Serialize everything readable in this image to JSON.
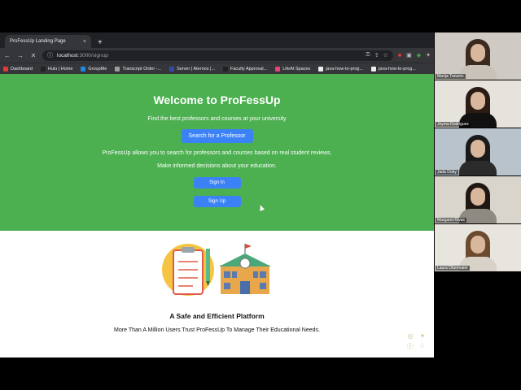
{
  "browser": {
    "tab": {
      "title": "ProFessUp Landing Page",
      "close": "×"
    },
    "new_tab": "+",
    "nav": {
      "back": "←",
      "forward": "→",
      "reload": "✕"
    },
    "address": {
      "host": "localhost",
      "path": ":3000/signup"
    },
    "bookmarks": [
      {
        "label": "Dashboard",
        "color": "#e53935"
      },
      {
        "label": "Hulu | Home",
        "color": "#222222"
      },
      {
        "label": "GroupMe",
        "color": "#1e88e5"
      },
      {
        "label": "Transcript Order -...",
        "color": "#9e9e9e"
      },
      {
        "label": "Server | Aternos |...",
        "color": "#3949ab"
      },
      {
        "label": "Faculty Approval...",
        "color": "#212121"
      },
      {
        "label": "LifeAt Spaces",
        "color": "#ec407a"
      },
      {
        "label": "java-how-to-prog...",
        "color": "#eeeeee"
      },
      {
        "label": "java-how-to-prog...",
        "color": "#eeeeee"
      }
    ]
  },
  "hero": {
    "title": "Welcome to ProFessUp",
    "subtitle": "Find the best professors and courses at your university",
    "search_button": "Search for a Professor",
    "desc1": "ProFessUp allows you to search for professors and courses based on real student reviews.",
    "desc2": "Make informed decisions about your education.",
    "signin_button": "Sign In",
    "signup_button": "Sign Up",
    "bg_color": "#4caf50",
    "button_color": "#3b82f6"
  },
  "feature": {
    "title": "A Safe and Efficient Platform",
    "tagline": "More Than A Million Users Trust ProFessUp To Manage Their Educational Needs."
  },
  "social_icons": [
    "instagram-icon",
    "twitter-icon",
    "facebook-icon",
    "snapchat-icon"
  ],
  "participants": [
    {
      "name": "Marija Traveric",
      "hair": "#3b2a20",
      "shirt": "#c9c2b8",
      "bg": "#cfcac4"
    },
    {
      "name": "Jeyma Rodriguez",
      "hair": "#2a1b14",
      "shirt": "#111111",
      "bg": "#e6e2dc"
    },
    {
      "name": "Jada Doby",
      "hair": "#1a1a1a",
      "shirt": "#2b2b2b",
      "bg": "#b9c3cc"
    },
    {
      "name": "Margaret Rivas",
      "hair": "#1f1712",
      "shirt": "#8e8a82",
      "bg": "#d9d4cc"
    },
    {
      "name": "Laura Obermaier",
      "hair": "#6b4a2f",
      "shirt": "#d8d2c8",
      "bg": "#e8e4de"
    }
  ]
}
